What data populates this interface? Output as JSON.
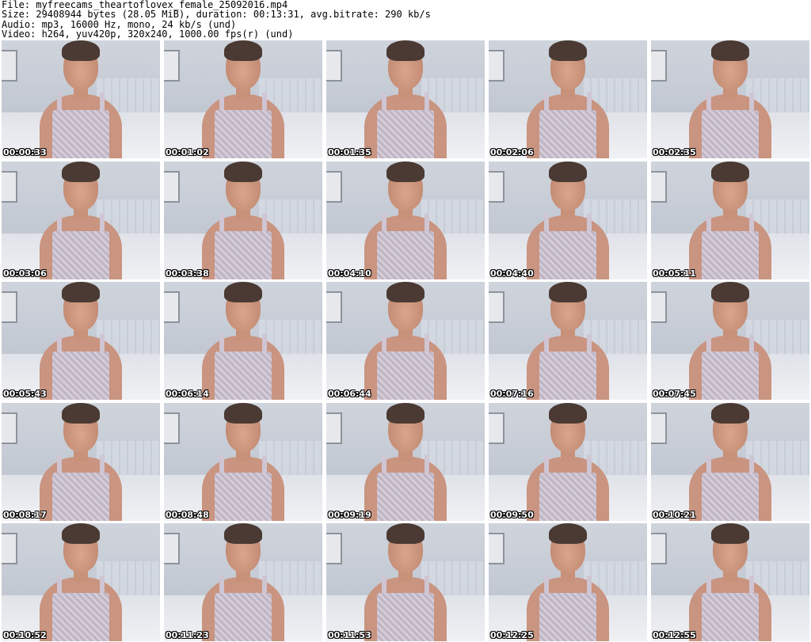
{
  "header": {
    "file_line": "File: myfreecams_theartoflovex_female_25092016.mp4",
    "size_line": "Size: 29408944 bytes (28.05 MiB), duration: 00:13:31, avg.bitrate: 290 kb/s",
    "audio_line": "Audio: mp3, 16000 Hz, mono, 24 kb/s (und)",
    "video_line": "Video: h264, yuv420p, 320x240, 1000.00 fps(r) (und)"
  },
  "thumbnails": [
    {
      "time": "00:00:33"
    },
    {
      "time": "00:01:02"
    },
    {
      "time": "00:01:35"
    },
    {
      "time": "00:02:06"
    },
    {
      "time": "00:02:35"
    },
    {
      "time": "00:03:06"
    },
    {
      "time": "00:03:38"
    },
    {
      "time": "00:04:10"
    },
    {
      "time": "00:04:40"
    },
    {
      "time": "00:05:11"
    },
    {
      "time": "00:05:43"
    },
    {
      "time": "00:06:14"
    },
    {
      "time": "00:06:44"
    },
    {
      "time": "00:07:16"
    },
    {
      "time": "00:07:45"
    },
    {
      "time": "00:08:17"
    },
    {
      "time": "00:08:48"
    },
    {
      "time": "00:09:19"
    },
    {
      "time": "00:09:50"
    },
    {
      "time": "00:10:21"
    },
    {
      "time": "00:10:52"
    },
    {
      "time": "00:11:23"
    },
    {
      "time": "00:11:53"
    },
    {
      "time": "00:12:25"
    },
    {
      "time": "00:12:55"
    }
  ]
}
